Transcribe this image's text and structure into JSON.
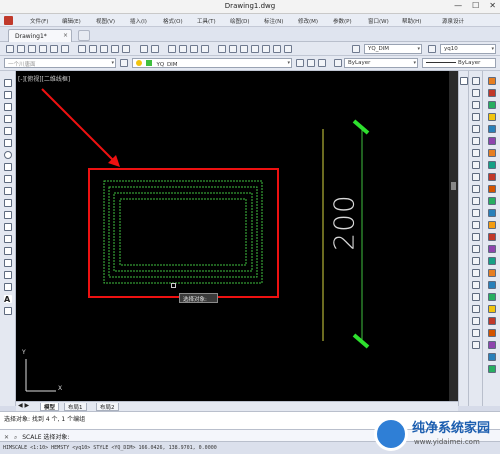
{
  "window": {
    "title": "Drawing1.dwg",
    "controls": [
      "—",
      "☐",
      "✕"
    ]
  },
  "menu": {
    "items": [
      "文件(F)",
      "编辑(E)",
      "视图(V)",
      "插入(I)",
      "格式(O)",
      "工具(T)",
      "绘图(D)",
      "标注(N)",
      "修改(M)",
      "参数(P)",
      "窗口(W)",
      "帮助(H)",
      "源泉设计"
    ]
  },
  "tabs": {
    "active": "Drawing1*",
    "close": "×"
  },
  "toolbar1": {
    "dimstyle": "YQ_DIM",
    "textstyle": "yq10"
  },
  "toolbar2": {
    "layer_hint": "一个川唐面",
    "current_layer": "YQ_DIM",
    "color": "ByLayer",
    "linetype": "ByLayer"
  },
  "viewport": {
    "label": "[-][俯视][二维线框]",
    "tooltip": "选择对象:",
    "dimension": "200"
  },
  "layout_tabs": [
    "模型",
    "布局1",
    "布局2"
  ],
  "command": {
    "history": "选择对象: 找到 4 个, 1 个编组",
    "prompt": "SCALE 选择对象:"
  },
  "status": {
    "text": "HIMSCALE <1:10> HEMSTY <yq10> STYLE <YQ_DIM>  166.0426, 138.9701, 0.0000"
  },
  "watermark": {
    "title": "纯净系统家园",
    "url": "www.yidaimei.com"
  },
  "colors": {
    "selection_red": "#e11111",
    "entity_green": "#3fbf3f",
    "grip_green": "#2ee02e",
    "dim_yellow": "#d6d641"
  }
}
